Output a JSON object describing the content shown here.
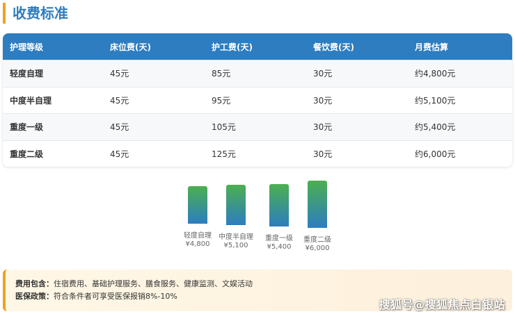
{
  "section": {
    "title": "收费标准"
  },
  "table": {
    "headers": [
      "护理等级",
      "床位费(天)",
      "护工费(天)",
      "餐饮费(天)",
      "月费估算"
    ],
    "rows": [
      [
        "轻度自理",
        "45元",
        "85元",
        "30元",
        "约4,800元"
      ],
      [
        "中度半自理",
        "45元",
        "95元",
        "30元",
        "约5,100元"
      ],
      [
        "重度一级",
        "45元",
        "105元",
        "30元",
        "约5,400元"
      ],
      [
        "重度二级",
        "45元",
        "125元",
        "30元",
        "约6,000元"
      ]
    ]
  },
  "chart_data": {
    "type": "bar",
    "categories": [
      "轻度自理",
      "中度半自理",
      "重度一级",
      "重度二级"
    ],
    "values": [
      4800,
      5100,
      5400,
      6000
    ],
    "value_labels": [
      "¥4,800",
      "¥5,100",
      "¥5,400",
      "¥6,000"
    ],
    "title": "",
    "xlabel": "",
    "ylabel": "",
    "ylim": [
      0,
      6000
    ],
    "grid": false,
    "colors": {
      "bar_top": "#4caf50",
      "bar_bottom": "#2d7dc0"
    }
  },
  "info": {
    "fee_label": "费用包含：",
    "fee_text": "住宿费用、基础护理服务、膳食服务、健康监测、文娱活动",
    "insurance_label": "医保政策：",
    "insurance_text": "符合条件者可享受医保报销8%-10%"
  },
  "watermark": "搜狐号@搜狐焦点白银站",
  "colors": {
    "accent": "#2d7dc0",
    "highlight": "#f0a020"
  }
}
